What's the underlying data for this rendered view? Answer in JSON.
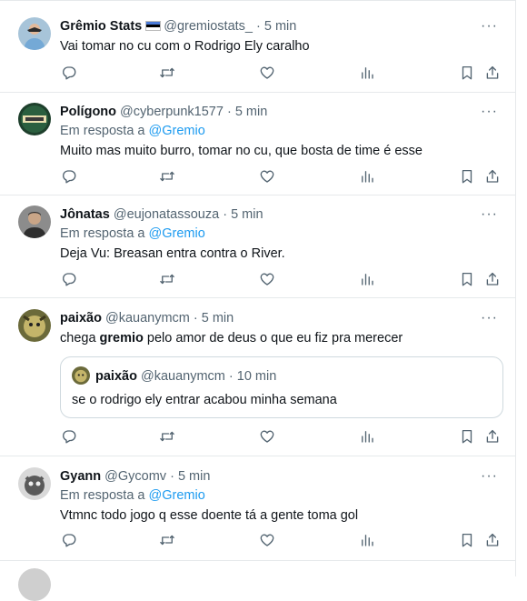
{
  "icons": {
    "more": "more-dots-icon",
    "reply": "reply-icon",
    "retweet": "retweet-icon",
    "like": "heart-icon",
    "views": "views-bars-icon",
    "bookmark": "bookmark-icon",
    "share": "share-icon"
  },
  "colors": {
    "link": "#1d9bf0",
    "muted": "#536471",
    "text": "#0f1419",
    "border": "#cfd9de"
  },
  "tweets": [
    {
      "name": "Grêmio Stats",
      "handle": "@gremiostats_",
      "dot": "·",
      "time": "5 min",
      "text": "Vai tomar no cu com o Rodrigo Ely caralho"
    },
    {
      "name": "Polígono",
      "handle": "@cyberpunk1577",
      "dot": "·",
      "time": "5 min",
      "reply_prefix": "Em resposta a",
      "reply_to": "@Gremio",
      "text": "Muito mas muito burro, tomar no cu, que bosta de time é esse"
    },
    {
      "name": "Jônatas",
      "handle": "@eujonatassouza",
      "dot": "·",
      "time": "5 min",
      "reply_prefix": "Em resposta a",
      "reply_to": "@Gremio",
      "text": "Deja Vu: Breasan entra contra o River."
    },
    {
      "name": "paixão",
      "handle": "@kauanymcm",
      "dot": "·",
      "time": "5 min",
      "text_before": "chega",
      "text_bold": "gremio",
      "text_after": "pelo amor de deus o que eu fiz pra merecer",
      "quote": {
        "name": "paixão",
        "handle": "@kauanymcm",
        "dot": "·",
        "time": "10 min",
        "text": "se o rodrigo ely entrar acabou minha semana"
      }
    },
    {
      "name": "Gyann",
      "handle": "@Gycomv",
      "dot": "·",
      "time": "5 min",
      "reply_prefix": "Em resposta a",
      "reply_to": "@Gremio",
      "text": "Vtmnc todo jogo q esse doente tá a gente toma gol"
    }
  ]
}
